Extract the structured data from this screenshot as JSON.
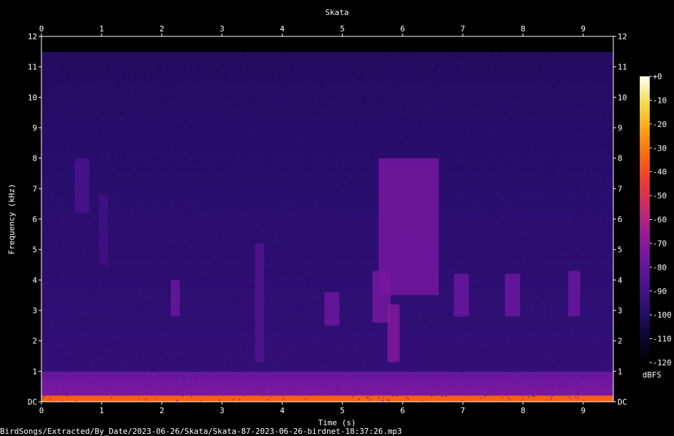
{
  "chart_data": {
    "type": "heatmap",
    "title": "Skata",
    "xlabel": "Time (s)",
    "ylabel": "Frequency (kHz)",
    "xlim": [
      0,
      9.5
    ],
    "ylim": [
      0,
      12
    ],
    "x_ticks": [
      "0",
      "1",
      "2",
      "3",
      "4",
      "5",
      "6",
      "7",
      "8",
      "9"
    ],
    "y_ticks": [
      "DC",
      "1",
      "2",
      "3",
      "4",
      "5",
      "6",
      "7",
      "8",
      "9",
      "10",
      "11",
      "12"
    ],
    "colorbar": {
      "label": "dBFS",
      "range": [
        -120,
        0
      ],
      "ticks": [
        "+0",
        "-10",
        "-20",
        "-30",
        "-40",
        "-50",
        "-60",
        "-70",
        "-80",
        "-90",
        "-100",
        "-110",
        "-120"
      ],
      "colormap": [
        "#000000",
        "#0c0633",
        "#2a0e6e",
        "#4b128d",
        "#7017a0",
        "#9b1b98",
        "#c92a6b",
        "#ee3b32",
        "#fc6c0c",
        "#fba613",
        "#f5dc52",
        "#fffff0"
      ]
    },
    "calls": [
      {
        "t_start": 0.55,
        "t_end": 0.8,
        "f_low": 6.2,
        "f_high": 8.0,
        "level_db": -88
      },
      {
        "t_start": 0.95,
        "t_end": 1.1,
        "f_low": 4.5,
        "f_high": 6.8,
        "level_db": -90
      },
      {
        "t_start": 2.15,
        "t_end": 2.3,
        "f_low": 2.8,
        "f_high": 4.0,
        "level_db": -78
      },
      {
        "t_start": 3.55,
        "t_end": 3.7,
        "f_low": 1.3,
        "f_high": 5.2,
        "level_db": -85
      },
      {
        "t_start": 4.7,
        "t_end": 4.95,
        "f_low": 2.5,
        "f_high": 3.6,
        "level_db": -78
      },
      {
        "t_start": 5.5,
        "t_end": 5.8,
        "f_low": 2.6,
        "f_high": 4.3,
        "level_db": -75
      },
      {
        "t_start": 5.75,
        "t_end": 5.95,
        "f_low": 1.3,
        "f_high": 3.2,
        "level_db": -72
      },
      {
        "t_start": 5.6,
        "t_end": 6.6,
        "f_low": 3.5,
        "f_high": 8.0,
        "level_db": -75
      },
      {
        "t_start": 6.85,
        "t_end": 7.1,
        "f_low": 2.8,
        "f_high": 4.2,
        "level_db": -78
      },
      {
        "t_start": 7.7,
        "t_end": 7.95,
        "f_low": 2.8,
        "f_high": 4.2,
        "level_db": -78
      },
      {
        "t_start": 8.75,
        "t_end": 8.95,
        "f_low": 2.8,
        "f_high": 4.3,
        "level_db": -78
      }
    ],
    "noise_floor_db": -95,
    "low_band": {
      "f_high": 1.0,
      "level_db": -72
    },
    "dc_band_level_db": -35
  },
  "footer": {
    "filename": "BirdSongs/Extracted/By_Date/2023-06-26/Skata/Skata-87-2023-06-26-birdnet-18:37:26.mp3"
  }
}
